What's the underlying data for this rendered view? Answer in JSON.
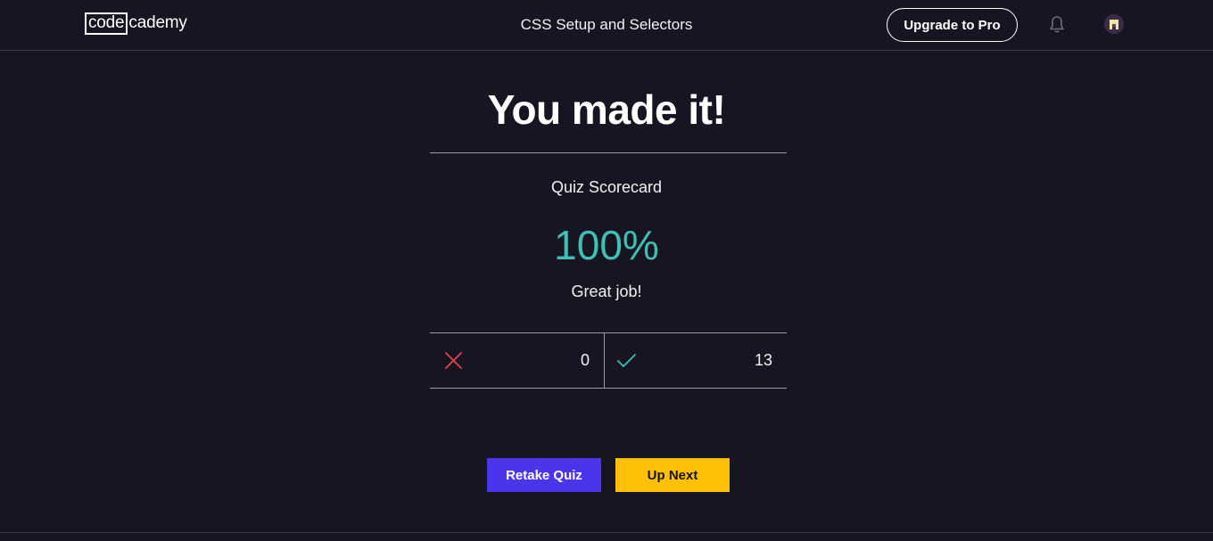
{
  "header": {
    "logo": {
      "boxed": "code",
      "rest": "cademy"
    },
    "lesson_title": "CSS Setup and Selectors",
    "upgrade_label": "Upgrade to Pro",
    "bell_icon": "bell-icon",
    "avatar_icon": "avatar"
  },
  "result": {
    "title": "You made it!",
    "scorecard_label": "Quiz Scorecard",
    "score": "100%",
    "message": "Great job!"
  },
  "tally": {
    "incorrect": {
      "icon": "x-icon",
      "count": "0"
    },
    "correct": {
      "icon": "check-icon",
      "count": "13"
    }
  },
  "actions": {
    "retake_label": "Retake Quiz",
    "next_label": "Up Next"
  },
  "colors": {
    "background": "#161521",
    "score": "#3ec0b5",
    "incorrect": "#e8424a",
    "correct": "#3ec0b5",
    "primary_button": "#4b35ea",
    "secondary_button": "#ffc107"
  }
}
